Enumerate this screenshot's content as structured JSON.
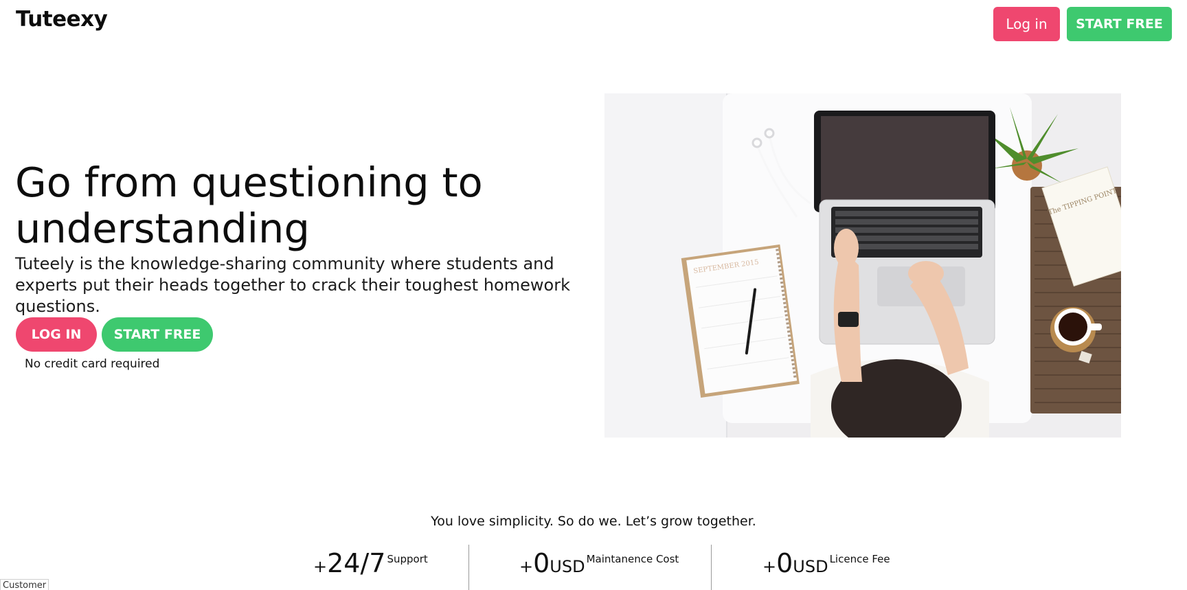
{
  "header": {
    "logo": "Tuteexy",
    "login_label": "Log in",
    "start_label": "START FREE"
  },
  "hero": {
    "title": "Go from questioning to understanding",
    "subtitle": "Tuteely is the knowledge-sharing community where students and experts put their heads together to crack their toughest homework questions.",
    "login_label": "LOG IN",
    "start_label": "START FREE",
    "note": "No credit card required",
    "image": {
      "notebook_text": "SEPTEMBER 2015",
      "book_text": "The TIPPING POINT"
    }
  },
  "stats": {
    "tagline": "You love simplicity. So do we. Let’s grow together.",
    "items": [
      {
        "prefix": "+",
        "value": "24/7",
        "unit": "",
        "label": "Support"
      },
      {
        "prefix": "+",
        "value": "0",
        "unit": "USD",
        "label": "Maintanence Cost"
      },
      {
        "prefix": "+",
        "value": "0",
        "unit": "USD",
        "label": "Licence Fee"
      }
    ]
  },
  "footer": {
    "customer_tag": "Customer"
  },
  "colors": {
    "login_pink": "#ef476f",
    "start_green": "#3ec96f",
    "text": "#111111"
  }
}
